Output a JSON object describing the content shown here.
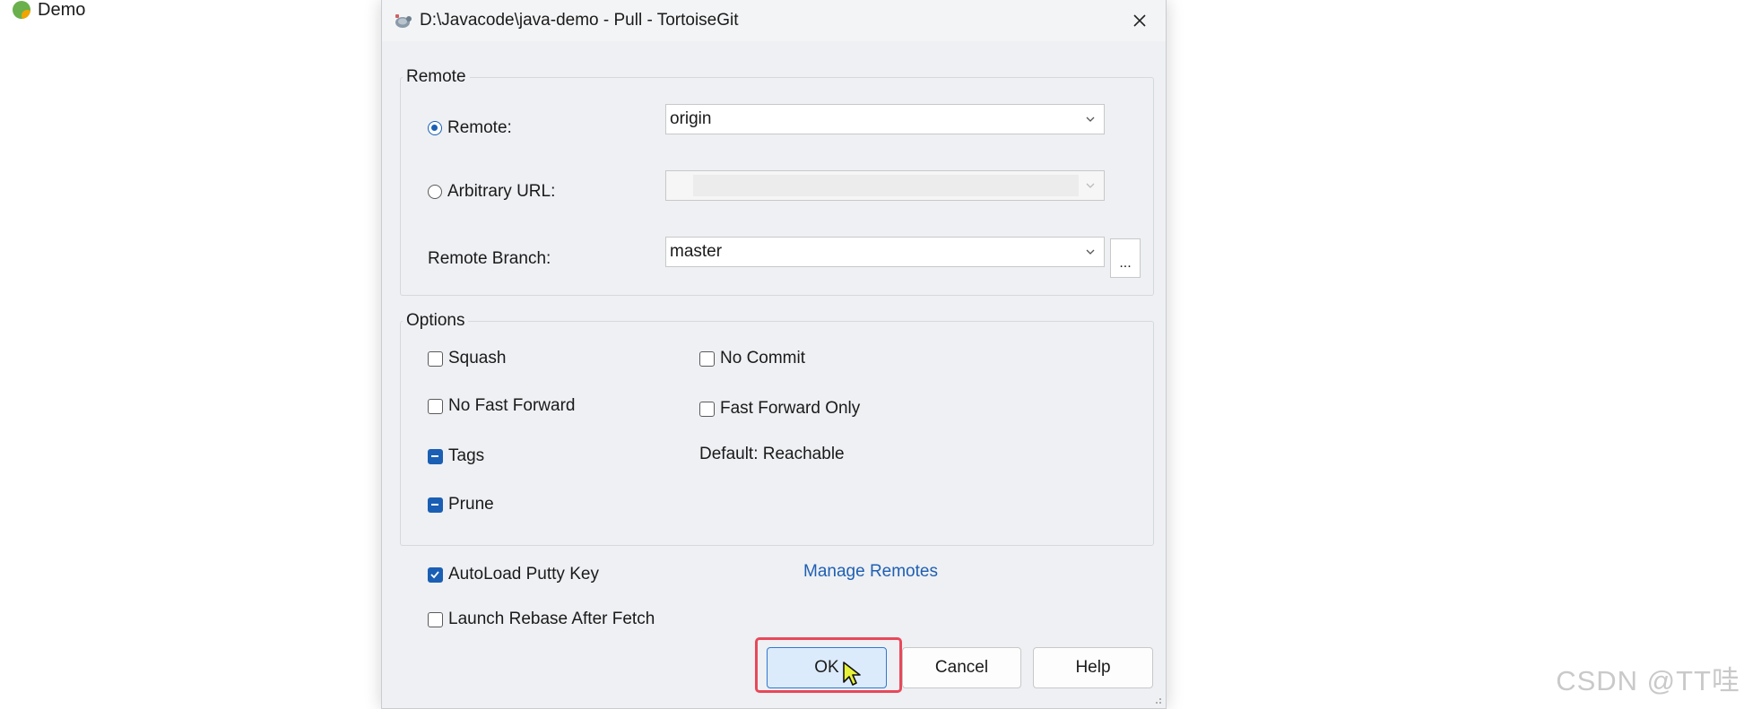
{
  "app": {
    "name": "Demo"
  },
  "dialog": {
    "title": "D:\\Javacode\\java-demo - Pull - TortoiseGit",
    "remote_group": {
      "label": "Remote",
      "remote_radio_label": "Remote:",
      "remote_value": "origin",
      "arbitrary_url_label": "Arbitrary URL:",
      "arbitrary_url_value": "",
      "remote_branch_label": "Remote Branch:",
      "remote_branch_value": "master",
      "browse_button_label": "..."
    },
    "options_group": {
      "label": "Options",
      "squash": "Squash",
      "no_commit": "No Commit",
      "no_fast_forward": "No Fast Forward",
      "fast_forward_only": "Fast Forward Only",
      "tags": "Tags",
      "default_note": "Default: Reachable",
      "prune": "Prune"
    },
    "autoload_putty_key": "AutoLoad Putty Key",
    "manage_remotes": "Manage Remotes",
    "launch_rebase": "Launch Rebase After Fetch",
    "buttons": {
      "ok": "OK",
      "cancel": "Cancel",
      "help": "Help"
    }
  },
  "watermark": "CSDN @TT哇",
  "colors": {
    "accent": "#1a5fb4",
    "highlight": "#e8485a",
    "link": "#1f5fb3"
  },
  "icons": {
    "app": "demo-logo-icon",
    "dialog": "tortoisegit-icon",
    "close": "close-icon",
    "dropdown": "chevron-down-icon",
    "cursor": "mouse-cursor-icon",
    "grip": "resize-grip-icon"
  }
}
